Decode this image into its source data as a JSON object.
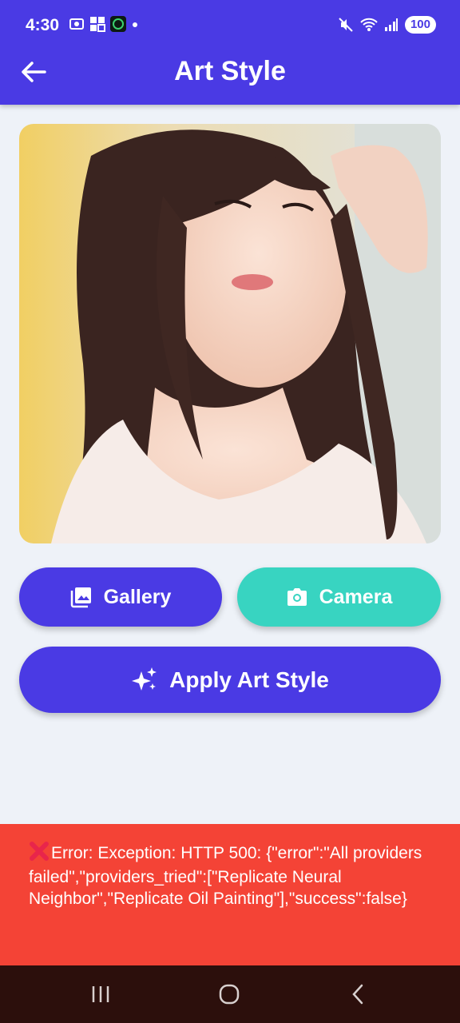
{
  "status_bar": {
    "time": "4:30",
    "battery": "100"
  },
  "header": {
    "title": "Art Style"
  },
  "buttons": {
    "gallery": "Gallery",
    "camera": "Camera",
    "apply": "Apply Art Style"
  },
  "error": {
    "message": "Error: Exception: HTTP 500: {\"error\":\"All providers failed\",\"providers_tried\":[\"Replicate Neural Neighbor\",\"Replicate Oil Painting\"],\"success\":false}"
  },
  "colors": {
    "primary": "#4a3ae4",
    "accent": "#38d4c1",
    "error": "#f44336",
    "background": "#eef2f8"
  },
  "icons": {
    "back": "arrow-left-icon",
    "gallery": "image-icon",
    "camera": "camera-icon",
    "apply": "sparkles-icon",
    "error": "cross-mark-icon"
  }
}
